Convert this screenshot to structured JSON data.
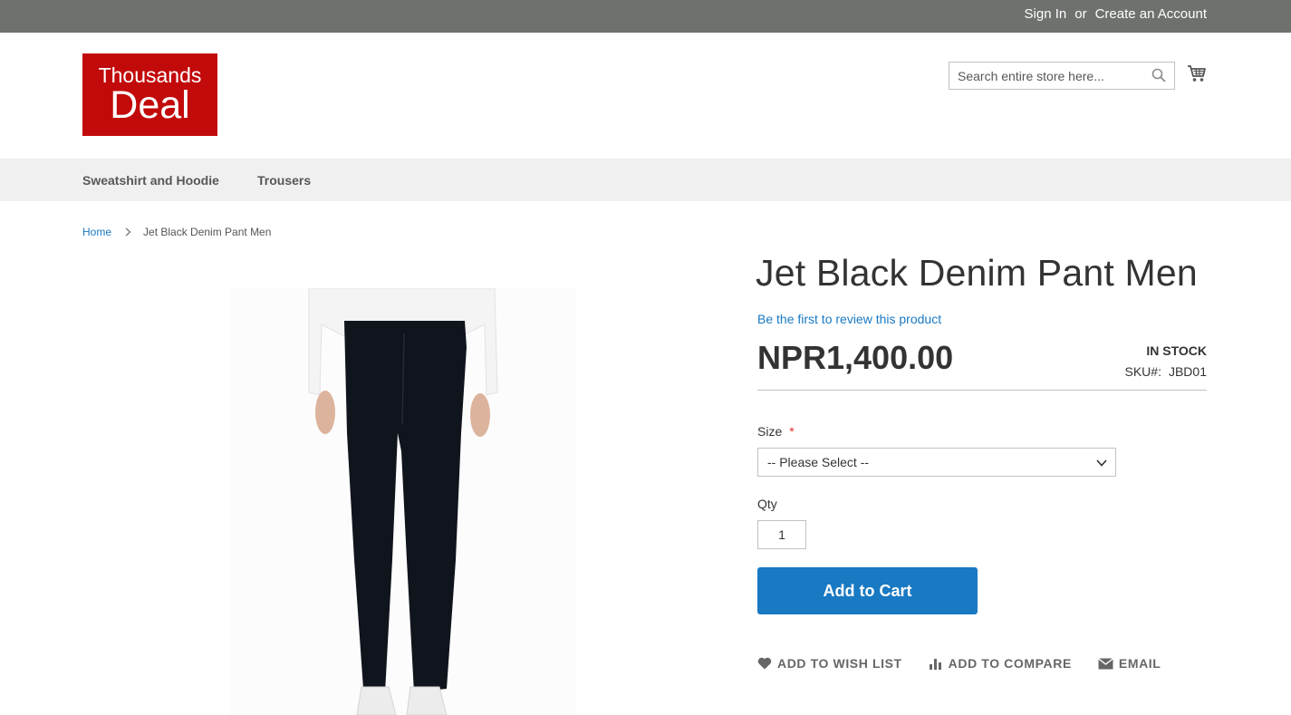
{
  "header": {
    "sign_in": "Sign In",
    "or": "or",
    "create_account": "Create an Account"
  },
  "logo": {
    "line1": "Thousands",
    "line2": "Deal"
  },
  "search": {
    "placeholder": "Search entire store here..."
  },
  "nav": {
    "items": [
      {
        "label": "Sweatshirt and Hoodie"
      },
      {
        "label": "Trousers"
      }
    ]
  },
  "breadcrumb": {
    "home": "Home",
    "current": "Jet Black Denim Pant Men"
  },
  "product": {
    "title": "Jet Black Denim Pant Men",
    "review_link": "Be the first to review this product",
    "price": "NPR1,400.00",
    "stock": "IN STOCK",
    "sku_label": "SKU#:",
    "sku": "JBD01",
    "size_label": "Size",
    "size_required": "*",
    "size_value": "-- Please Select --",
    "qty_label": "Qty",
    "qty_value": "1",
    "add_to_cart": "Add to Cart"
  },
  "actions": {
    "wishlist": "ADD TO WISH LIST",
    "compare": "ADD TO COMPARE",
    "email": "EMAIL"
  },
  "colors": {
    "topbar": "#6e716e",
    "brand_red": "#c20a0a",
    "link_blue": "#1979c3",
    "nav_bg": "#f0f0f0"
  },
  "icons": [
    "search-icon",
    "cart-icon",
    "chevron-right-icon",
    "chevron-down-icon",
    "heart-icon",
    "compare-icon",
    "envelope-icon"
  ]
}
